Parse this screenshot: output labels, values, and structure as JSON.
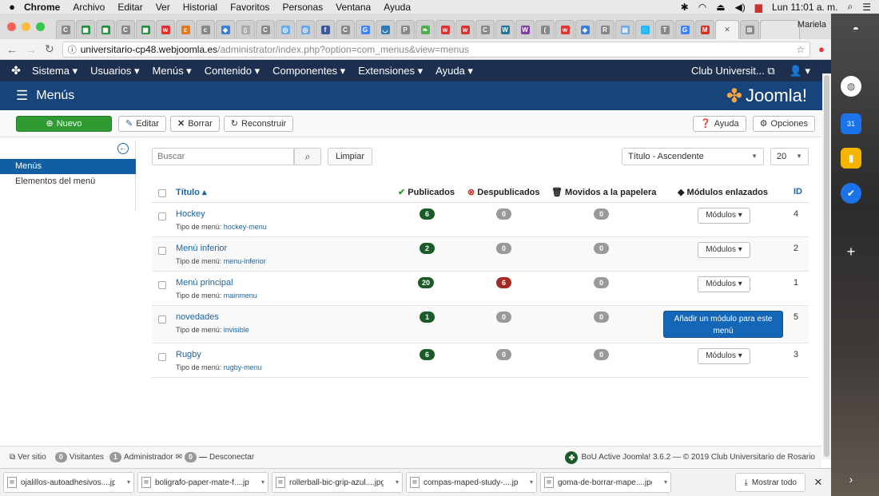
{
  "macbar": {
    "app": "Chrome",
    "menus": [
      "Archivo",
      "Editar",
      "Ver",
      "Historial",
      "Favoritos",
      "Personas",
      "Ventana",
      "Ayuda"
    ],
    "clock": "Lun 11:01 a. m."
  },
  "browser": {
    "user": "Mariela",
    "url_host": "universitario-cp48.webjoomla.es",
    "url_path": "/administrator/index.php?option=com_menus&view=menus"
  },
  "nav": {
    "items": [
      "Sistema ▾",
      "Usuarios ▾",
      "Menús ▾",
      "Contenido ▾",
      "Componentes ▾",
      "Extensiones ▾",
      "Ayuda ▾"
    ],
    "site": "Club Universit...",
    "user_menu": "▾"
  },
  "header": {
    "title": "Menús",
    "brand": "Joomla!"
  },
  "toolbar": {
    "new": "Nuevo",
    "edit": "Editar",
    "delete": "Borrar",
    "rebuild": "Reconstruir",
    "help": "Ayuda",
    "options": "Opciones"
  },
  "sidebar": {
    "items": [
      "Menús",
      "Elementos del menú"
    ]
  },
  "filters": {
    "search_placeholder": "Buscar",
    "clear": "Limpiar",
    "sort": "Título - Ascendente",
    "limit": "20"
  },
  "table": {
    "headers": {
      "title": "Título ▴",
      "published": "Publicados",
      "unpublished": "Despublicados",
      "trashed": "Movidos a la papelera",
      "modules": "Módulos enlazados",
      "id": "ID"
    },
    "type_label": "Tipo de menú:",
    "modules_btn": "Módulos ▾",
    "add_module": "Añadir un módulo para este menú",
    "rows": [
      {
        "title": "Hockey",
        "type": "hockey-menu",
        "published": "6",
        "unpublished": "0",
        "trashed": "0",
        "id": "4"
      },
      {
        "title": "Menú inferior",
        "type": "menu-inferior",
        "published": "2",
        "unpublished": "0",
        "trashed": "0",
        "id": "2"
      },
      {
        "title": "Menú principal",
        "type": "mainmenu",
        "published": "20",
        "unpublished": "6",
        "trashed": "0",
        "id": "1"
      },
      {
        "title": "novedades",
        "type": "invisible",
        "published": "1",
        "unpublished": "0",
        "trashed": "0",
        "id": "5"
      },
      {
        "title": "Rugby",
        "type": "rugby-menu",
        "published": "6",
        "unpublished": "0",
        "trashed": "0",
        "id": "3"
      }
    ]
  },
  "status": {
    "view_site": "Ver sitio",
    "visitors_count": "0",
    "visitors": "Visitantes",
    "admin_count": "1",
    "admin": "Administrador",
    "messages_count": "0",
    "logout": "Desconectar",
    "footer": "BoU Active Joomla! 3.6.2 — © 2019 Club Universitario de Rosario"
  },
  "downloads": {
    "files": [
      "ojalillos-autoadhesivos....jpg",
      "boligrafo-paper-mate-f....jpg",
      "rollerball-bic-grip-azul....jpg",
      "compas-maped-study-....jpg",
      "goma-de-borrar-mape....jpg"
    ],
    "show_all": "Mostrar todo"
  },
  "colors": {
    "nav": "#1c2f4e",
    "header": "#17447a",
    "new": "#2f9a31",
    "link": "#1b64a3",
    "badge_green": "#1b5b28",
    "badge_red": "#a12a22"
  }
}
